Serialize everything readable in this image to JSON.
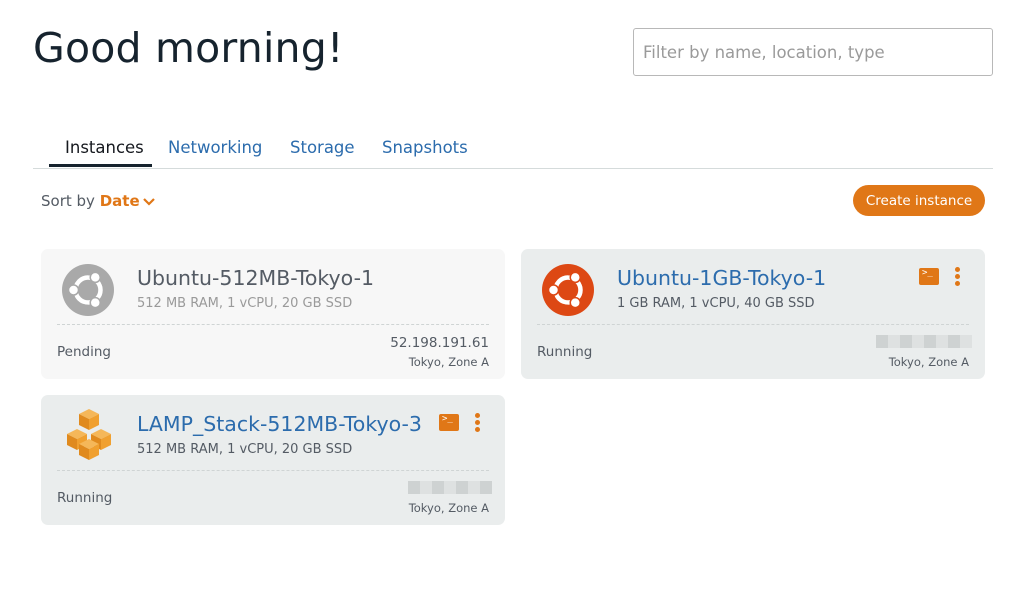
{
  "header": {
    "greeting": "Good morning!"
  },
  "filter": {
    "placeholder": "Filter by name, location, type",
    "value": ""
  },
  "tabs": [
    {
      "label": "Instances",
      "active": true
    },
    {
      "label": "Networking",
      "active": false
    },
    {
      "label": "Storage",
      "active": false
    },
    {
      "label": "Snapshots",
      "active": false
    }
  ],
  "sort": {
    "label": "Sort by",
    "value": "Date"
  },
  "actions": {
    "create_label": "Create instance"
  },
  "colors": {
    "accent": "#e07717",
    "link": "#2c6cad",
    "ubuntu": "#dd4814",
    "pending_icon": "#a9a9a9",
    "lamp": "#f0a030"
  },
  "instances": [
    {
      "name": "Ubuntu-512MB-Tokyo-1",
      "spec": "512 MB RAM, 1 vCPU, 20 GB SSD",
      "state": "Pending",
      "ip": "52.198.191.61",
      "zone": "Tokyo, Zone A",
      "icon": "ubuntu-icon"
    },
    {
      "name": "Ubuntu-1GB-Tokyo-1",
      "spec": "1 GB RAM, 1 vCPU, 40 GB SSD",
      "state": "Running",
      "ip": "",
      "zone": "Tokyo, Zone A",
      "icon": "ubuntu-icon"
    },
    {
      "name": "LAMP_Stack-512MB-Tokyo-3",
      "spec": "512 MB RAM, 1 vCPU, 20 GB SSD",
      "state": "Running",
      "ip": "",
      "zone": "Tokyo, Zone A",
      "icon": "lamp-stack-icon"
    }
  ]
}
